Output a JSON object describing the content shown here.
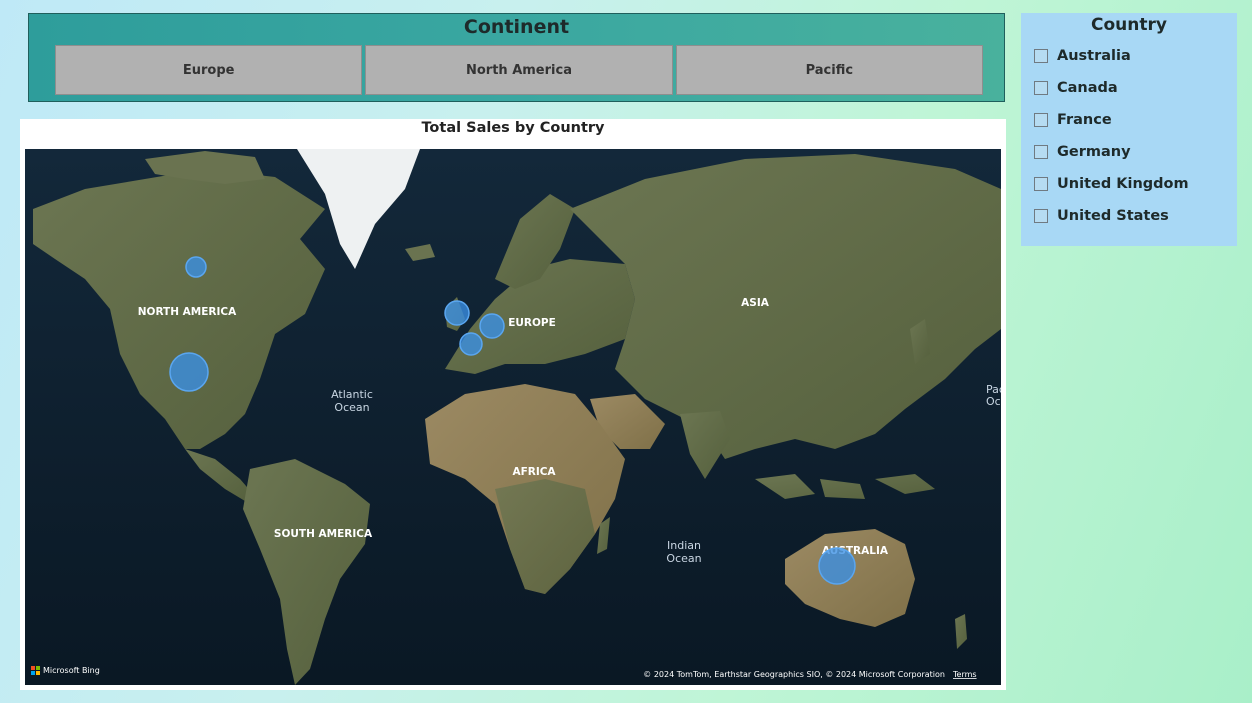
{
  "continent_slicer": {
    "title": "Continent",
    "tiles": [
      "Europe",
      "North America",
      "Pacific"
    ]
  },
  "country_slicer": {
    "title": "Country",
    "items": [
      "Australia",
      "Canada",
      "France",
      "Germany",
      "United Kingdom",
      "United States"
    ]
  },
  "map": {
    "title": "Total Sales by Country",
    "region_labels": {
      "north_america": "NORTH AMERICA",
      "europe": "EUROPE",
      "asia": "ASIA",
      "africa": "AFRICA",
      "south_america": "SOUTH AMERICA",
      "australia": "AUSTRALIA",
      "atlantic_1": "Atlantic",
      "atlantic_2": "Ocean",
      "indian_1": "Indian",
      "indian_2": "Ocean",
      "pacific_1": "Pac",
      "pacific_2": "Oc"
    },
    "bubbles": [
      {
        "country": "Canada"
      },
      {
        "country": "United States"
      },
      {
        "country": "United Kingdom"
      },
      {
        "country": "Germany"
      },
      {
        "country": "France"
      },
      {
        "country": "Australia"
      }
    ],
    "attribution": "© 2024 TomTom, Earthstar Geographics SIO, © 2024 Microsoft Corporation",
    "terms_link": "Terms",
    "provider": "Microsoft Bing",
    "colors": {
      "bubble": "#3a8fe6",
      "ocean": "#0b1d2b",
      "land": "#5f6a45"
    }
  }
}
